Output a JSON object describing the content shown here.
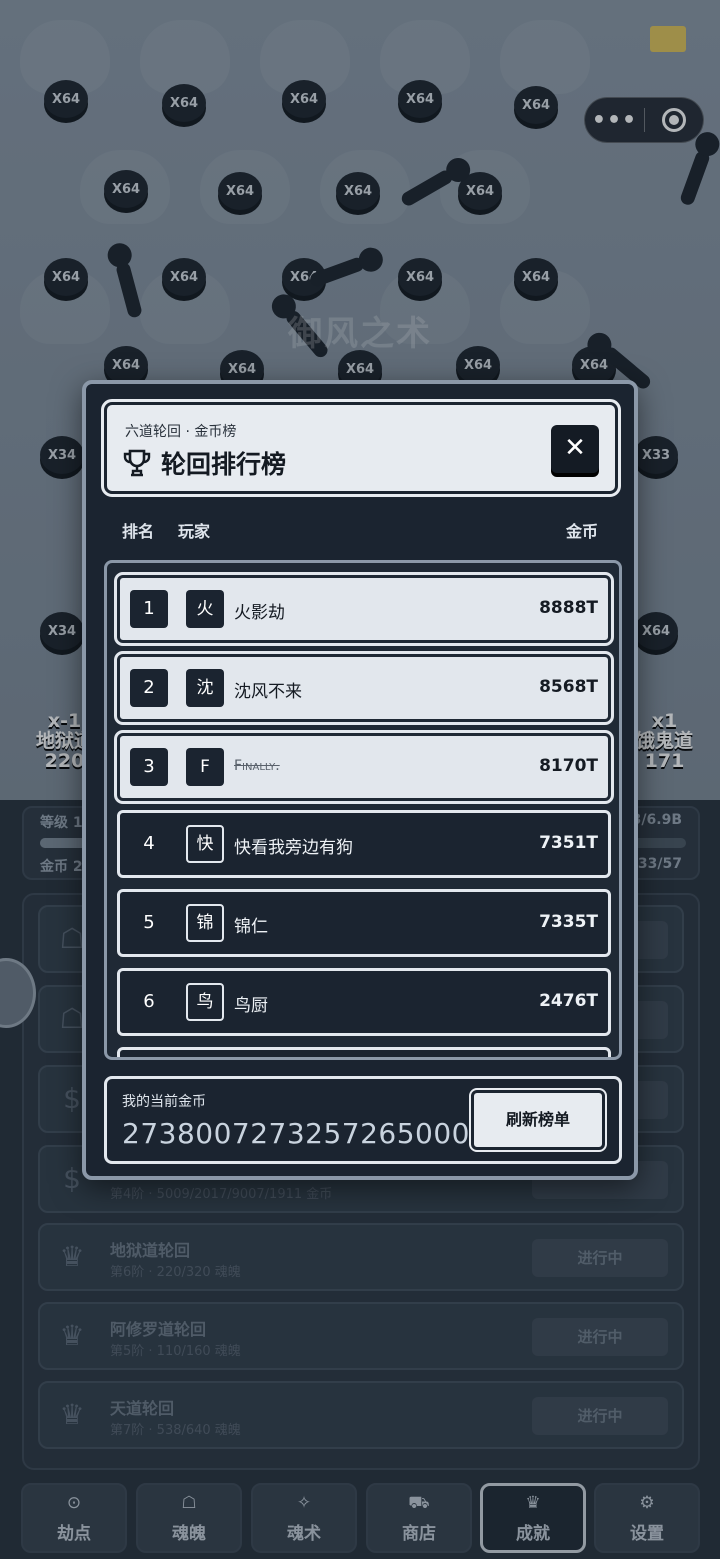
{
  "background": {
    "coin_label": "X64",
    "coin_labels_side": [
      "X34",
      "X33"
    ],
    "title_text": "御风之术",
    "left_tag": [
      "x-1",
      "地狱道",
      "220"
    ],
    "right_tag": [
      "x1",
      "饿鬼道",
      "171"
    ]
  },
  "capsule": {
    "menu_dots": "•••"
  },
  "stats": {
    "level_label": "等级 1",
    "coins_label": "金币 2",
    "right_top": "3/6.9B",
    "right_bottom": "33/57"
  },
  "tasks": [
    {
      "title": "",
      "sub": "",
      "button": ""
    },
    {
      "title": "",
      "sub": "",
      "button": ""
    },
    {
      "title": "",
      "sub": "",
      "button": ""
    },
    {
      "title": "",
      "sub": "第4阶 · 5009/2017/9007/1911 金币",
      "button": ""
    },
    {
      "title": "地狱道轮回",
      "sub": "第6阶 · 220/320 魂魄",
      "button": "进行中"
    },
    {
      "title": "阿修罗道轮回",
      "sub": "第5阶 · 110/160 魂魄",
      "button": "进行中"
    },
    {
      "title": "天道轮回",
      "sub": "第7阶 · 538/640 魂魄",
      "button": "进行中"
    }
  ],
  "nav": [
    {
      "label": "劫点",
      "icon": "⊙"
    },
    {
      "label": "魂魄",
      "icon": "☖"
    },
    {
      "label": "魂术",
      "icon": "✧"
    },
    {
      "label": "商店",
      "icon": "⛟"
    },
    {
      "label": "成就",
      "icon": "♛"
    },
    {
      "label": "设置",
      "icon": "⚙"
    }
  ],
  "modal": {
    "subtitle": "六道轮回 · 金币榜",
    "title": "轮回排行榜",
    "close": "✕",
    "col_rank": "排名",
    "col_player": "玩家",
    "col_coins": "金币",
    "rows": [
      {
        "rank": "1",
        "avatar": "火",
        "name": "火影劫",
        "coins": "8888T"
      },
      {
        "rank": "2",
        "avatar": "沈",
        "name": "沈风不来",
        "coins": "8568T"
      },
      {
        "rank": "3",
        "avatar": "F",
        "name": "Finally.",
        "coins": "8170T"
      },
      {
        "rank": "4",
        "avatar": "快",
        "name": "快看我旁边有狗",
        "coins": "7351T"
      },
      {
        "rank": "5",
        "avatar": "锦",
        "name": "锦仁",
        "coins": "7335T"
      },
      {
        "rank": "6",
        "avatar": "鸟",
        "name": "鸟厨",
        "coins": "2476T"
      }
    ],
    "my_coins_label": "我的当前金币",
    "my_coins_value": "273800727325726500000",
    "refresh": "刷新榜单"
  }
}
